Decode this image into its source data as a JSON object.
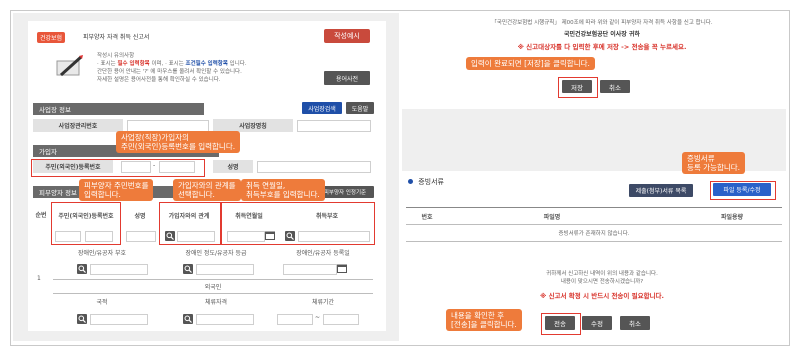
{
  "left": {
    "badge": "건강보험",
    "form_title": "피부양자 자격 취득 신고서",
    "example_button": "작성예시",
    "notice": {
      "title": "작성시 유의사항",
      "line1_prefix": "· 표시는",
      "line1_red": "필수 입력항목",
      "line1_mid": "이며, · 표시는",
      "line1_blue": "조건필수 입력항목",
      "line1_suffix": "입니다.",
      "line2": "간단한 용어 안내는 '?' 에 마우스를 올려서 확인할 수 있습니다.",
      "line3": "자세한 설명은 용어사전을 통해 확인하실 수 있습니다."
    },
    "dictionary_button": "용어사전",
    "workplace": {
      "header": "사업장 정보",
      "search_btn": "사업장검색",
      "help_btn": "도움말",
      "mgmt_no_label": "사업장관리번호",
      "name_label": "사업장명칭"
    },
    "subscriber": {
      "header": "가입자",
      "rrn_label": "주민(외국인)등록번호",
      "name_label": "성명"
    },
    "dependent": {
      "header": "피부양자 정보",
      "add_btn": "피부양자 인정기준",
      "col_no": "순번",
      "col_rrn": "주민(외국인)등록번호",
      "col_name": "성명",
      "col_relation": "가입자와의 관계",
      "col_acq_date": "취득연월일",
      "col_acq_code": "취득부호",
      "row2_disabled": "장애인/유공자 부호",
      "row2_grade": "장애인 정도/유공자 등급",
      "row2_date": "장애인/유공자 등록일",
      "row_no": "1",
      "foreign": "외국인",
      "col_nation": "국적",
      "col_stay": "체류자격",
      "col_period": "체류기간",
      "dash": "~"
    },
    "callouts": {
      "c1": "사업장(직장)가입자의\n주민(외국인)등록번호를 입력합니다.",
      "c2": "피부양자 주민번호를\n입력합니다.",
      "c3": "가입자와의 관계를\n선택합니다.",
      "c4": "취득 연월일,\n취득부호를 입력합니다."
    }
  },
  "right": {
    "law_text": "「국민건강보험법 시행규칙」 제00조에 따라 위와 같이 피부양자 자격 취득 사항을 신고 합니다.",
    "org_text": "국민건강보험공단 이사장 귀하",
    "warning1": "※ 신고대상자를 다 입력한 후에 저장 -> 전송을 꼭 누르세요.",
    "save_btn": "저장",
    "cancel_btn": "취소",
    "callout_save": "입력이 완료되면 [저장]을 클릭합니다.",
    "docs": {
      "header": "증빙서류",
      "submit_list_btn": "제출(첨부)서류 목록",
      "register_btn": "파일 등록/수정",
      "col_no": "번호",
      "col_name": "파일명",
      "col_size": "파일용량",
      "empty": "증빙서류가 존재하지 않습니다."
    },
    "callout_docs": "증빙서류\n등록 가능합니다.",
    "confirm1": "귀하께서 신고하신 내역이 위의 내용과 같습니다.",
    "confirm2": "내용이 맞으시면 전송하시겠습니까?",
    "warning2": "※ 신고서 확정 시 반드시 전송이 필요합니다.",
    "send_btn": "전송",
    "edit_btn": "수정",
    "cancel2_btn": "취소",
    "callout_send": "내용을 확인한 후\n[전송]을 클릭합니다."
  }
}
